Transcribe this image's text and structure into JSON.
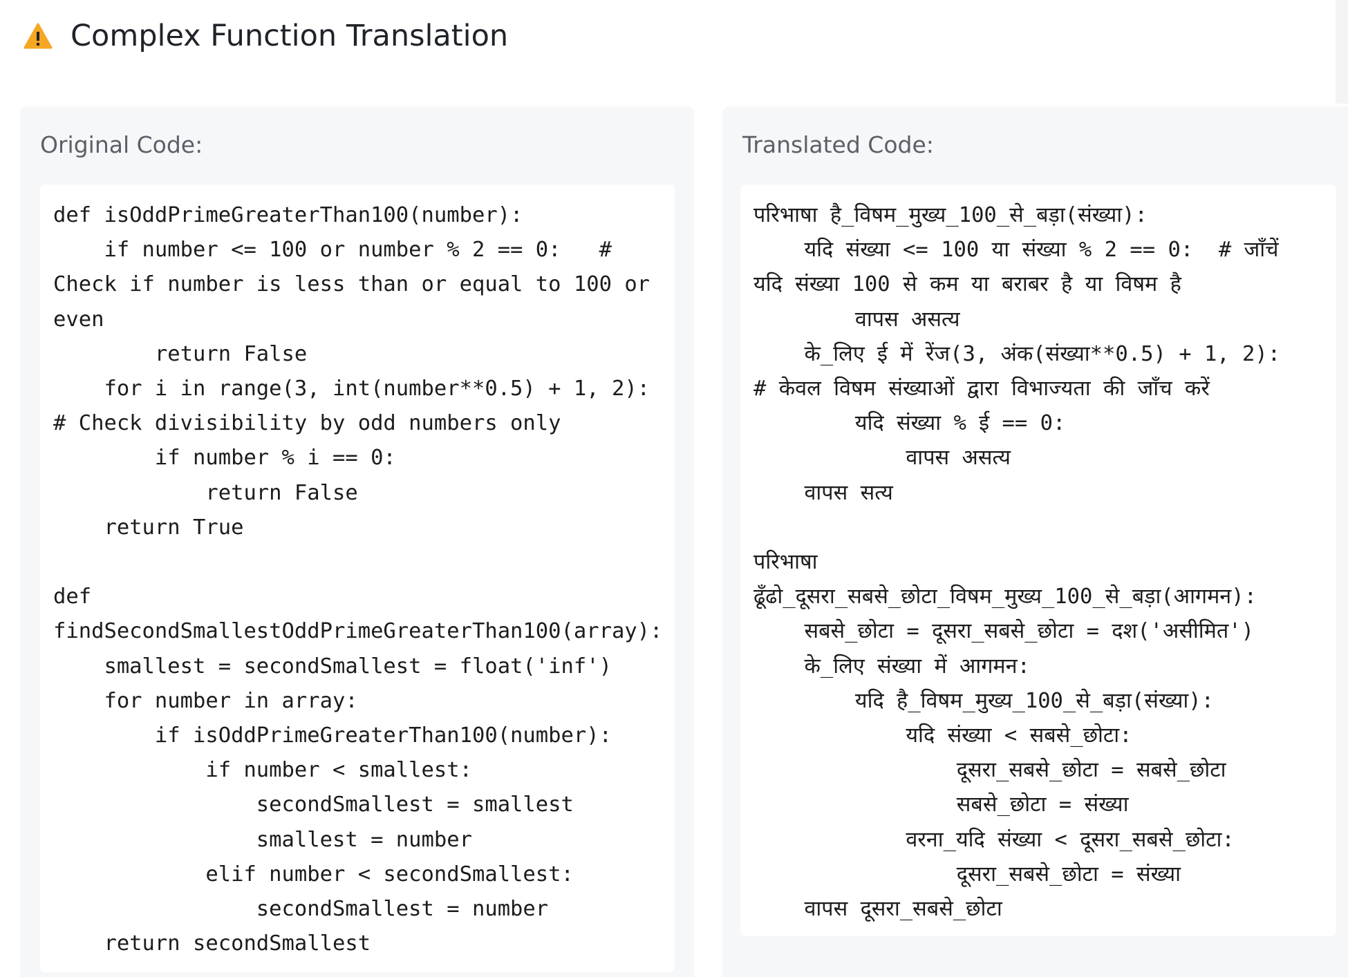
{
  "header": {
    "icon": "warning-icon",
    "title": "Complex Function Translation"
  },
  "original": {
    "label": "Original Code:",
    "lines": [
      "def isOddPrimeGreaterThan100(number):",
      "    if number <= 100 or number % 2 == 0:   #",
      "Check if number is less than or equal to 100 or",
      "even",
      "        return False",
      "    for i in range(3, int(number**0.5) + 1, 2):",
      "# Check divisibility by odd numbers only",
      "        if number % i == 0:",
      "            return False",
      "    return True",
      "",
      "def",
      "findSecondSmallestOddPrimeGreaterThan100(array):",
      "    smallest = secondSmallest = float('inf')",
      "    for number in array:",
      "        if isOddPrimeGreaterThan100(number):",
      "            if number < smallest:",
      "                secondSmallest = smallest",
      "                smallest = number",
      "            elif number < secondSmallest:",
      "                secondSmallest = number",
      "    return secondSmallest"
    ]
  },
  "translated": {
    "label": "Translated Code:",
    "lines": [
      "परिभाषा है_विषम_मुख्य_100_से_बड़ा(संख्या):",
      "    यदि संख्या <= 100 या संख्या % 2 == 0:  # जाँचें",
      "यदि संख्या 100 से कम या बराबर है या विषम है",
      "        वापस असत्य",
      "    के_लिए ई में रेंज(3, अंक(संख्या**0.5) + 1, 2):",
      "# केवल विषम संख्याओं द्वारा विभाज्यता की जाँच करें",
      "        यदि संख्या % ई == 0:",
      "            वापस असत्य",
      "    वापस सत्य",
      "",
      "परिभाषा",
      "ढूँढो_दूसरा_सबसे_छोटा_विषम_मुख्य_100_से_बड़ा(आगमन):",
      "    सबसे_छोटा = दूसरा_सबसे_छोटा = दश('असीमित')",
      "    के_लिए संख्या में आगमन:",
      "        यदि है_विषम_मुख्य_100_से_बड़ा(संख्या):",
      "            यदि संख्या < सबसे_छोटा:",
      "                दूसरा_सबसे_छोटा = सबसे_छोटा",
      "                सबसे_छोटा = संख्या",
      "            वरना_यदि संख्या < दूसरा_सबसे_छोटा:",
      "                दूसरा_सबसे_छोटा = संख्या",
      "    वापस दूसरा_सबसे_छोटा"
    ]
  },
  "colors": {
    "warning": "#f5a623",
    "panel_bg": "#f6f7f8",
    "code_bg": "#ffffff",
    "text": "#1c1c1c",
    "label": "#5b6068"
  }
}
